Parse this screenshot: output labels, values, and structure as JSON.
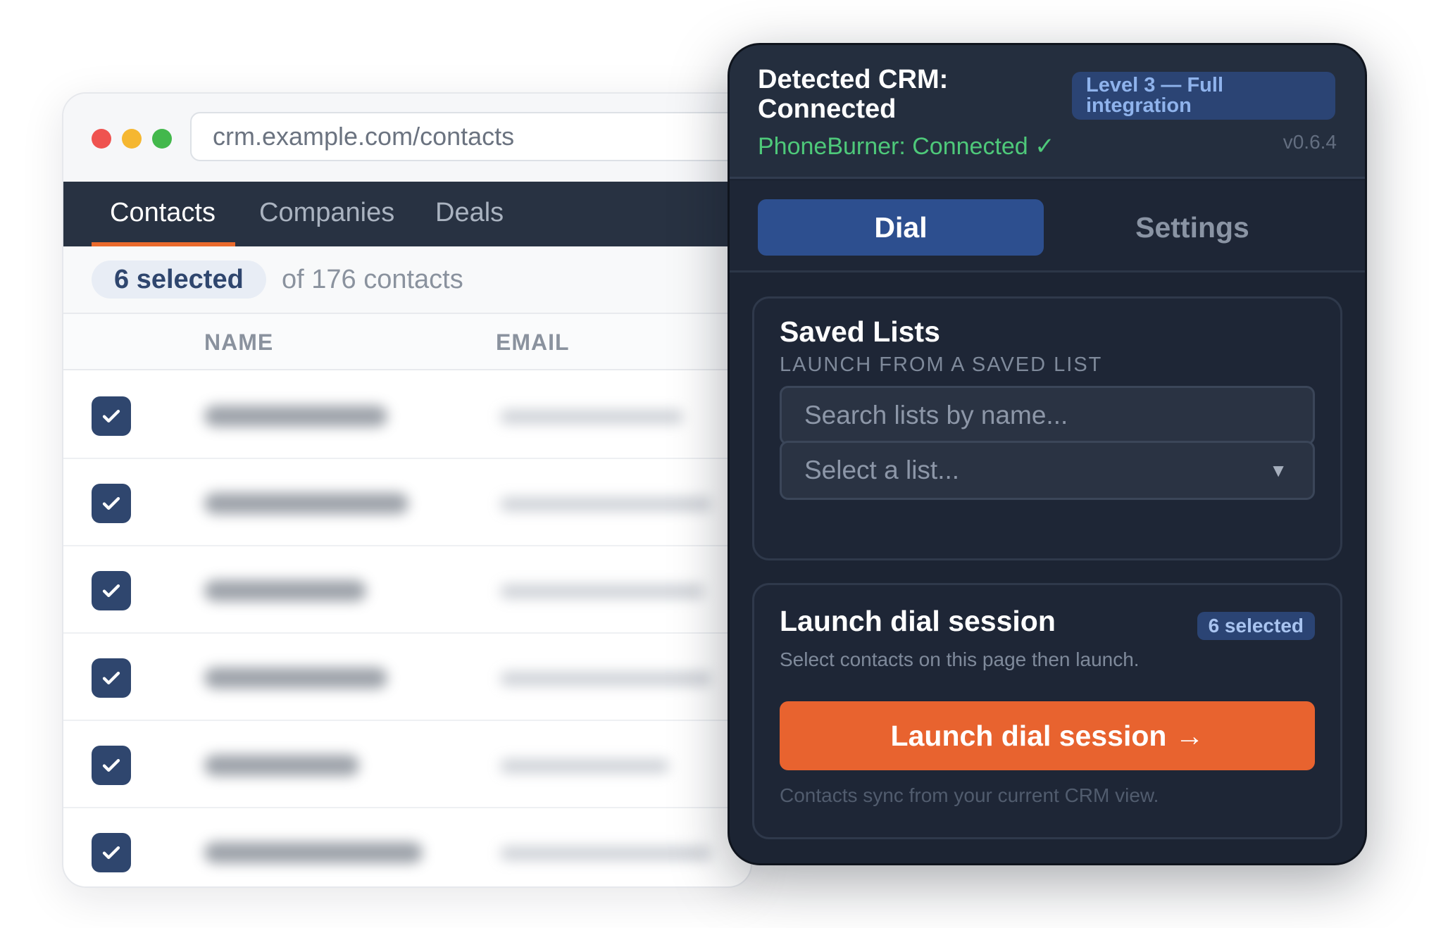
{
  "browser": {
    "url": "crm.example.com/contacts",
    "nav_tabs": [
      {
        "label": "Contacts",
        "active": true
      },
      {
        "label": "Companies",
        "active": false
      },
      {
        "label": "Deals",
        "active": false
      }
    ],
    "selected_pill": "6 selected",
    "selected_of": "of 176 contacts",
    "columns": [
      "NAME",
      "EMAIL"
    ],
    "rows_checked": [
      true,
      true,
      true,
      true,
      true,
      true
    ]
  },
  "panel": {
    "crm_title": "Detected CRM: Connected",
    "level_badge": "Level 3 — Full integration",
    "phoneburner_status": "PhoneBurner: Connected ✓",
    "version": "v0.6.4",
    "tabs": [
      {
        "label": "Dial",
        "active": true
      },
      {
        "label": "Settings",
        "active": false
      }
    ],
    "saved_lists": {
      "title": "Saved Lists",
      "subtitle": "LAUNCH FROM A SAVED LIST",
      "search_placeholder": "Search lists by name...",
      "select_placeholder": "Select a list...",
      "select_caret": "▼"
    },
    "launch": {
      "title": "Launch dial session",
      "badge": "6 selected",
      "description": "Select contacts on this page then launch.",
      "button_label": "Launch dial session",
      "button_arrow": "→",
      "footnote": "Contacts sync from your current CRM view."
    }
  },
  "colors": {
    "accent_orange": "#e8632f",
    "panel_bg": "#1c2433",
    "dial_tab": "#2d4f8f",
    "connected_green": "#4ec97a",
    "crm_nav": "#283242"
  }
}
